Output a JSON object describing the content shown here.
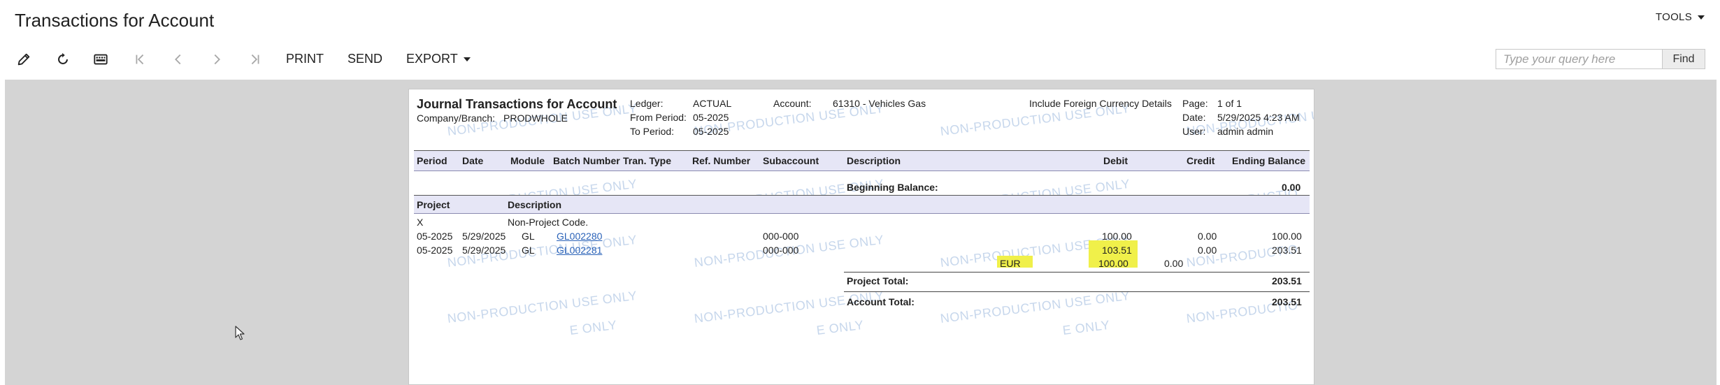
{
  "page_title": "Transactions for Account",
  "tools_label": "TOOLS",
  "toolbar": {
    "print_label": "PRINT",
    "send_label": "SEND",
    "export_label": "EXPORT",
    "search_placeholder": "Type your query here",
    "find_label": "Find"
  },
  "report": {
    "title": "Journal Transactions for Account",
    "company_label": "Company/Branch:",
    "company_value": "PRODWHOLE",
    "ledger_label": "Ledger:",
    "ledger_value": "ACTUAL",
    "from_period_label": "From Period:",
    "from_period_value": "05-2025",
    "to_period_label": "To Period:",
    "to_period_value": "05-2025",
    "account_label": "Account:",
    "account_value": "61310 - Vehicles Gas",
    "foreign_currency_label": "Include Foreign Currency Details",
    "page_label": "Page:",
    "page_value": "1 of 1",
    "date_label": "Date:",
    "date_value": "5/29/2025 4:23 AM",
    "user_label": "User:",
    "user_value": "admin admin",
    "columns": {
      "period": "Period",
      "date": "Date",
      "module": "Module",
      "batch": "Batch Number",
      "tran_type": "Tran. Type",
      "ref": "Ref. Number",
      "subaccount": "Subaccount",
      "description": "Description",
      "debit": "Debit",
      "credit": "Credit",
      "ending": "Ending Balance"
    },
    "beginning_balance_label": "Beginning Balance:",
    "beginning_balance_value": "0.00",
    "project_header": "Project",
    "project_desc_header": "Description",
    "project_code": "X",
    "project_desc": "Non-Project Code.",
    "rows": [
      {
        "period": "05-2025",
        "date": "5/29/2025",
        "module": "GL",
        "batch": "GL002280",
        "subaccount": "000-000",
        "debit": "100.00",
        "credit": "0.00",
        "ending": "100.00"
      },
      {
        "period": "05-2025",
        "date": "5/29/2025",
        "module": "GL",
        "batch": "GL002281",
        "subaccount": "000-000",
        "debit": "103.51",
        "credit": "0.00",
        "ending": "203.51"
      }
    ],
    "currency_row": {
      "currency": "EUR",
      "debit": "100.00",
      "credit": "0.00"
    },
    "project_total_label": "Project Total:",
    "project_total_value": "203.51",
    "account_total_label": "Account Total:",
    "account_total_value": "203.51",
    "watermark": "NON-PRODUCTION USE ONLY",
    "watermark_partial": "E ONLY",
    "watermark_edge": "NON-PRODUCTION U",
    "watermark_edge_short": "NON-PRODUCTIO"
  },
  "colors": {
    "workspace_bg": "#d4d4d4",
    "header_band": "#e6e6f6",
    "highlight": "#f0f04a",
    "link": "#2a62b8",
    "watermark": "#c7d7ec"
  }
}
